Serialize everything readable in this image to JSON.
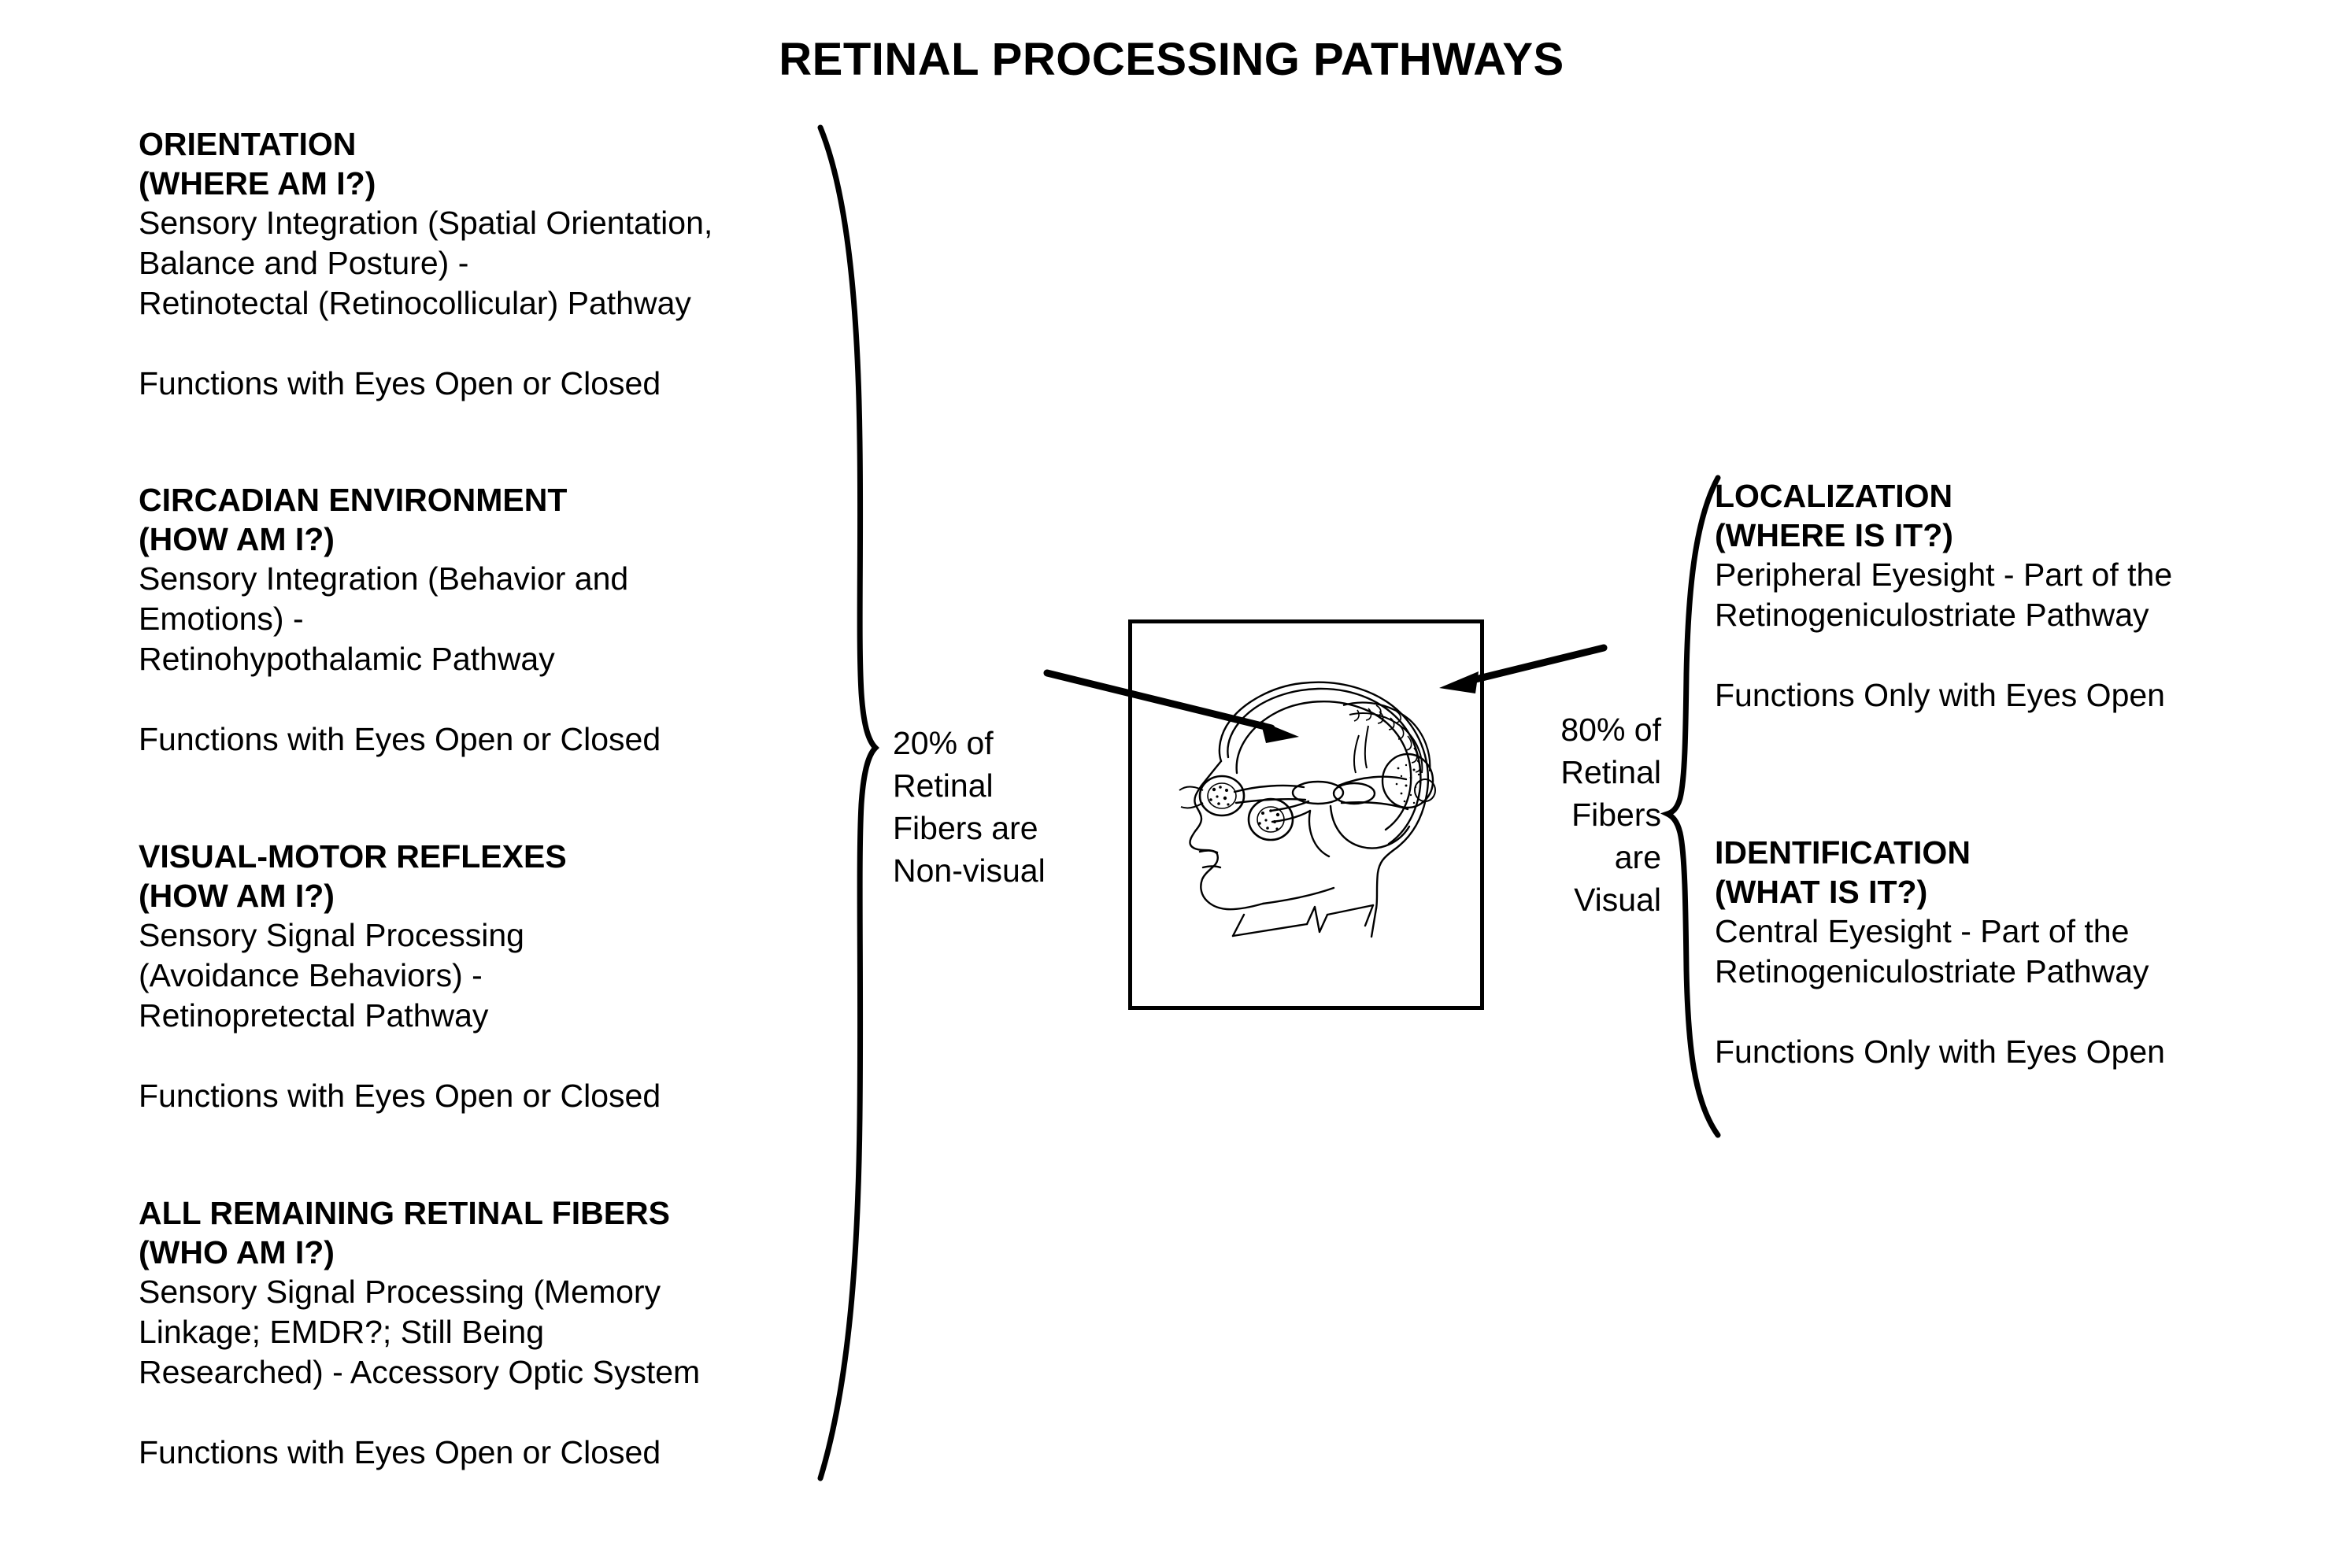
{
  "title": "RETINAL PROCESSING PATHWAYS",
  "left_column": {
    "blocks": [
      {
        "heading": "ORIENTATION",
        "subheading": "(WHERE AM I?)",
        "lines": [
          "Sensory Integration (Spatial Orientation,",
          "Balance and Posture) -",
          "Retinotectal (Retinocollicular) Pathway"
        ],
        "footer": "Functions with Eyes Open or Closed"
      },
      {
        "heading": "CIRCADIAN ENVIRONMENT",
        "subheading": "(HOW AM I?)",
        "lines": [
          "Sensory Integration (Behavior and",
          "Emotions) -",
          "Retinohypothalamic Pathway"
        ],
        "footer": "Functions with Eyes Open or Closed"
      },
      {
        "heading": "VISUAL-MOTOR REFLEXES",
        "subheading": "(HOW AM I?)",
        "lines": [
          "Sensory Signal Processing",
          "(Avoidance Behaviors) -",
          "Retinopretectal Pathway"
        ],
        "footer": "Functions with Eyes Open or Closed"
      },
      {
        "heading": "ALL REMAINING RETINAL FIBERS",
        "subheading": "(WHO AM I?)",
        "lines": [
          "Sensory Signal Processing (Memory",
          "Linkage; EMDR?; Still Being",
          "Researched) - Accessory Optic System"
        ],
        "footer": "Functions with Eyes Open or Closed"
      }
    ]
  },
  "right_column": {
    "blocks": [
      {
        "heading": "LOCALIZATION",
        "subheading": "(WHERE IS IT?)",
        "lines": [
          "Peripheral Eyesight - Part of the",
          "Retinogeniculostriate Pathway"
        ],
        "footer": "Functions Only with Eyes Open"
      },
      {
        "heading": "IDENTIFICATION",
        "subheading": "(WHAT IS IT?)",
        "lines": [
          "Central Eyesight - Part of the",
          "Retinogeniculostriate Pathway"
        ],
        "footer": "Functions Only with Eyes Open"
      }
    ]
  },
  "center": {
    "left_percent_lines": [
      "20% of",
      "Retinal",
      "Fibers are",
      "Non-visual"
    ],
    "right_percent_lines": [
      "80% of",
      "Retinal",
      "Fibers",
      "are",
      "Visual"
    ],
    "diagram_caption": "sagittal head with visual pathway anatomy"
  },
  "colors": {
    "ink": "#000000",
    "paper": "#ffffff"
  }
}
